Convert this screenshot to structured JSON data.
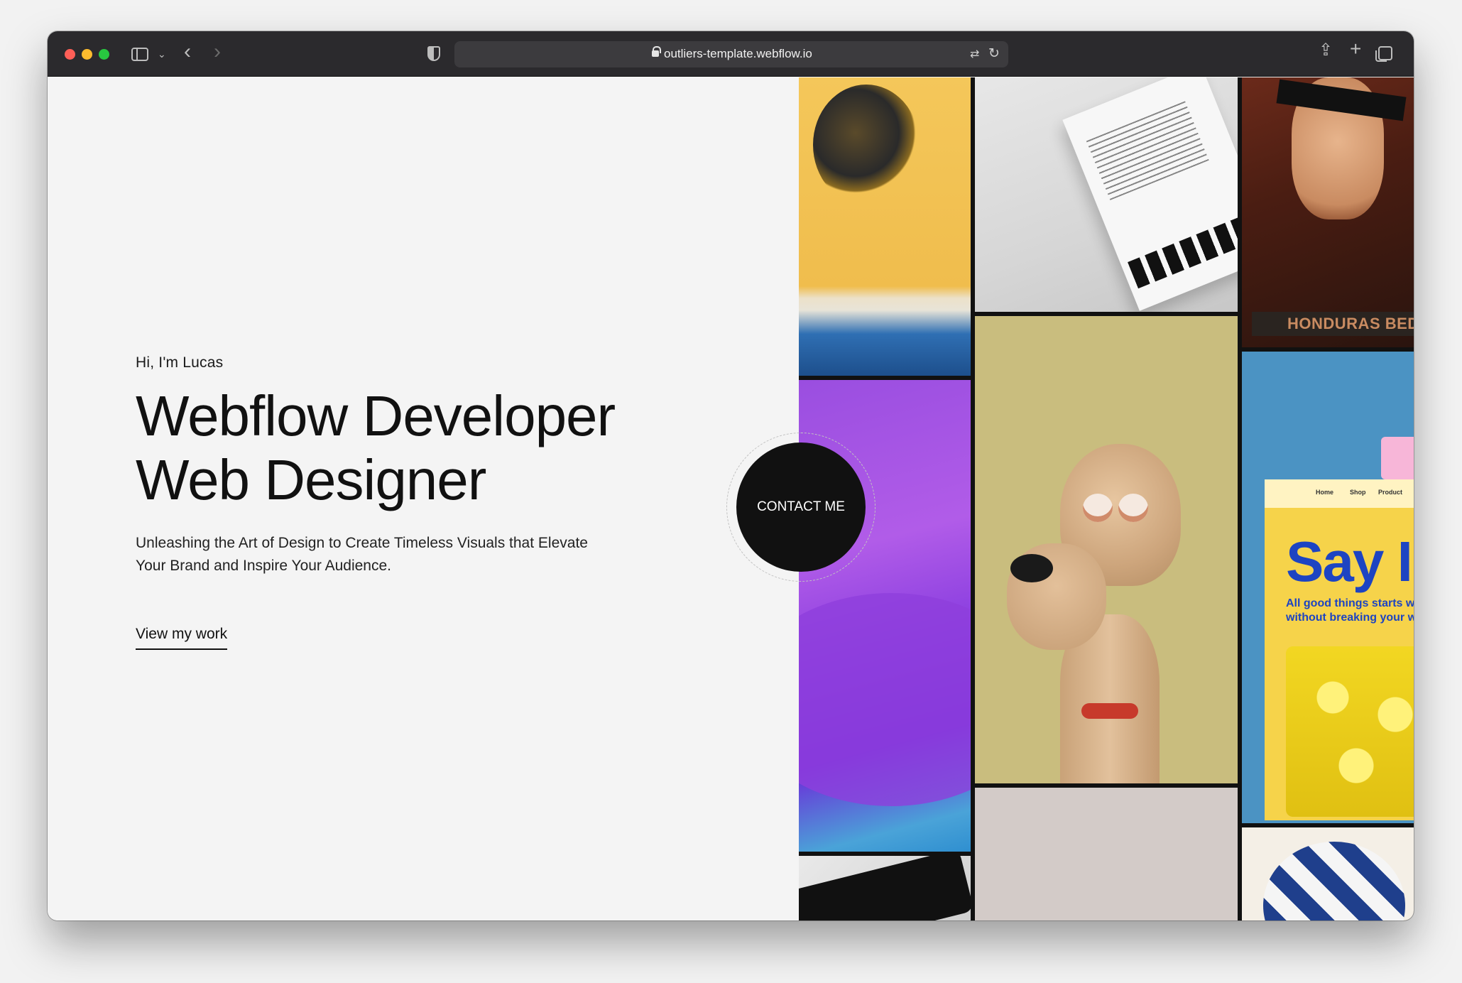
{
  "browser": {
    "url": "outliers-template.webflow.io"
  },
  "hero": {
    "greeting": "Hi, I'm Lucas",
    "headline_line1": "Webflow Developer",
    "headline_line2": "Web Designer",
    "tagline": "Unleashing the Art of Design to Create Timeless Visuals that Elevate Your Brand and Inspire Your Audience.",
    "cta_link": "View my work"
  },
  "contact": {
    "label": "CONTACT ME"
  },
  "gallery": {
    "poster_sign": "HONDURAS BED LEI",
    "ui_card": {
      "nav": [
        "Home",
        "Shop",
        "Product"
      ],
      "headline": "Say I",
      "subline1": "All good things starts wi",
      "subline2": "without breaking your w"
    }
  },
  "colors": {
    "page_bg": "#f4f4f4",
    "text": "#111111",
    "button_bg": "#111111",
    "toolbar_bg": "#2b2a2d"
  }
}
